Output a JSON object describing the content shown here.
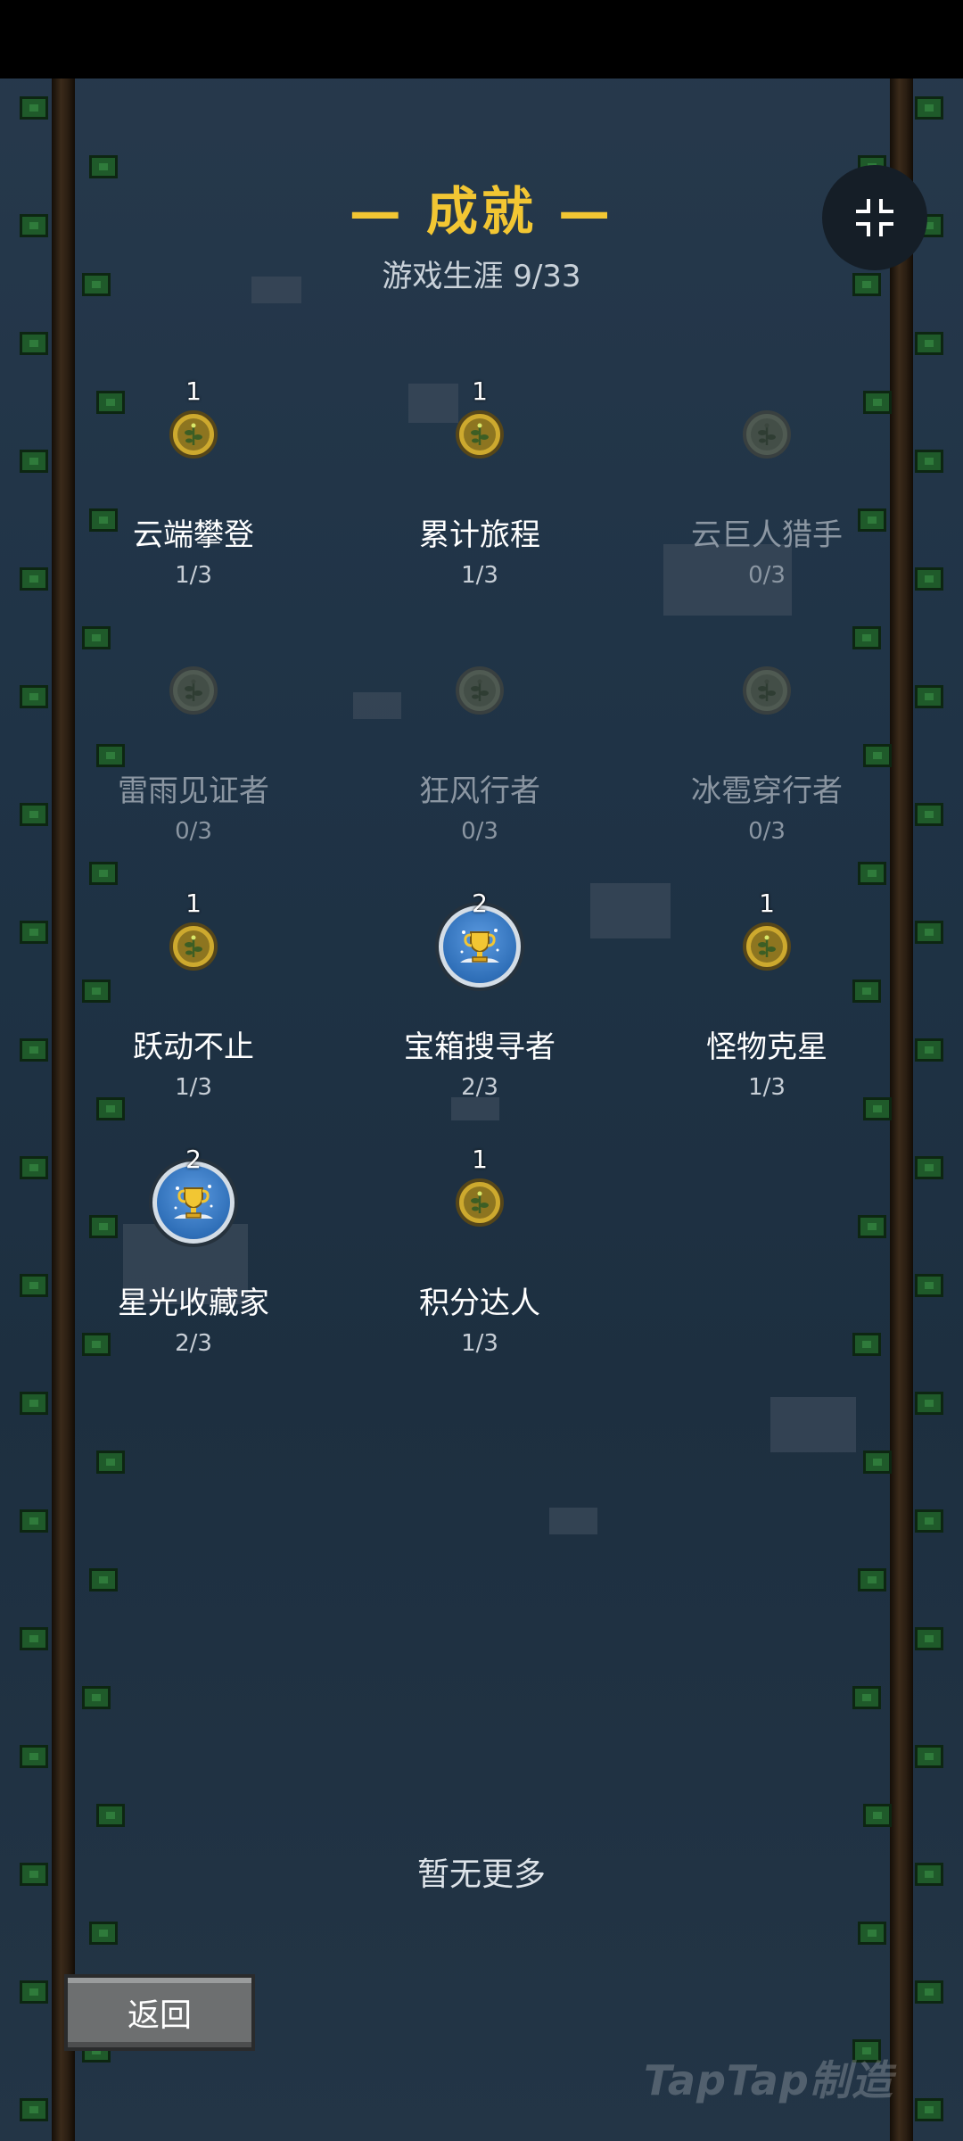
{
  "header": {
    "title": "— 成就 —",
    "subtitle": "游戏生涯  9/33"
  },
  "collapse_button": {
    "icon": "collapse-arrows-icon"
  },
  "achievements": [
    {
      "name": "云端攀登",
      "progress": "1/3",
      "level": "1",
      "badge": "gold-medal",
      "unlocked": true
    },
    {
      "name": "累计旅程",
      "progress": "1/3",
      "level": "1",
      "badge": "gold-medal",
      "unlocked": true
    },
    {
      "name": "云巨人猎手",
      "progress": "0/3",
      "level": "",
      "badge": "locked-medal",
      "unlocked": false
    },
    {
      "name": "雷雨见证者",
      "progress": "0/3",
      "level": "",
      "badge": "locked-medal",
      "unlocked": false
    },
    {
      "name": "狂风行者",
      "progress": "0/3",
      "level": "",
      "badge": "locked-medal",
      "unlocked": false
    },
    {
      "name": "冰雹穿行者",
      "progress": "0/3",
      "level": "",
      "badge": "locked-medal",
      "unlocked": false
    },
    {
      "name": "跃动不止",
      "progress": "1/3",
      "level": "1",
      "badge": "gold-medal",
      "unlocked": true
    },
    {
      "name": "宝箱搜寻者",
      "progress": "2/3",
      "level": "2",
      "badge": "trophy-badge",
      "unlocked": true
    },
    {
      "name": "怪物克星",
      "progress": "1/3",
      "level": "1",
      "badge": "gold-medal",
      "unlocked": true
    },
    {
      "name": "星光收藏家",
      "progress": "2/3",
      "level": "2",
      "badge": "trophy-badge",
      "unlocked": true
    },
    {
      "name": "积分达人",
      "progress": "1/3",
      "level": "1",
      "badge": "gold-medal",
      "unlocked": true
    }
  ],
  "footer": {
    "no_more": "暂无更多",
    "back_label": "返回",
    "watermark": "TapTap制造"
  },
  "colors": {
    "title": "#f2c633",
    "background": "#1f3346",
    "medal_gold": "#cda92e",
    "trophy_blue": "#2f6fb8"
  }
}
